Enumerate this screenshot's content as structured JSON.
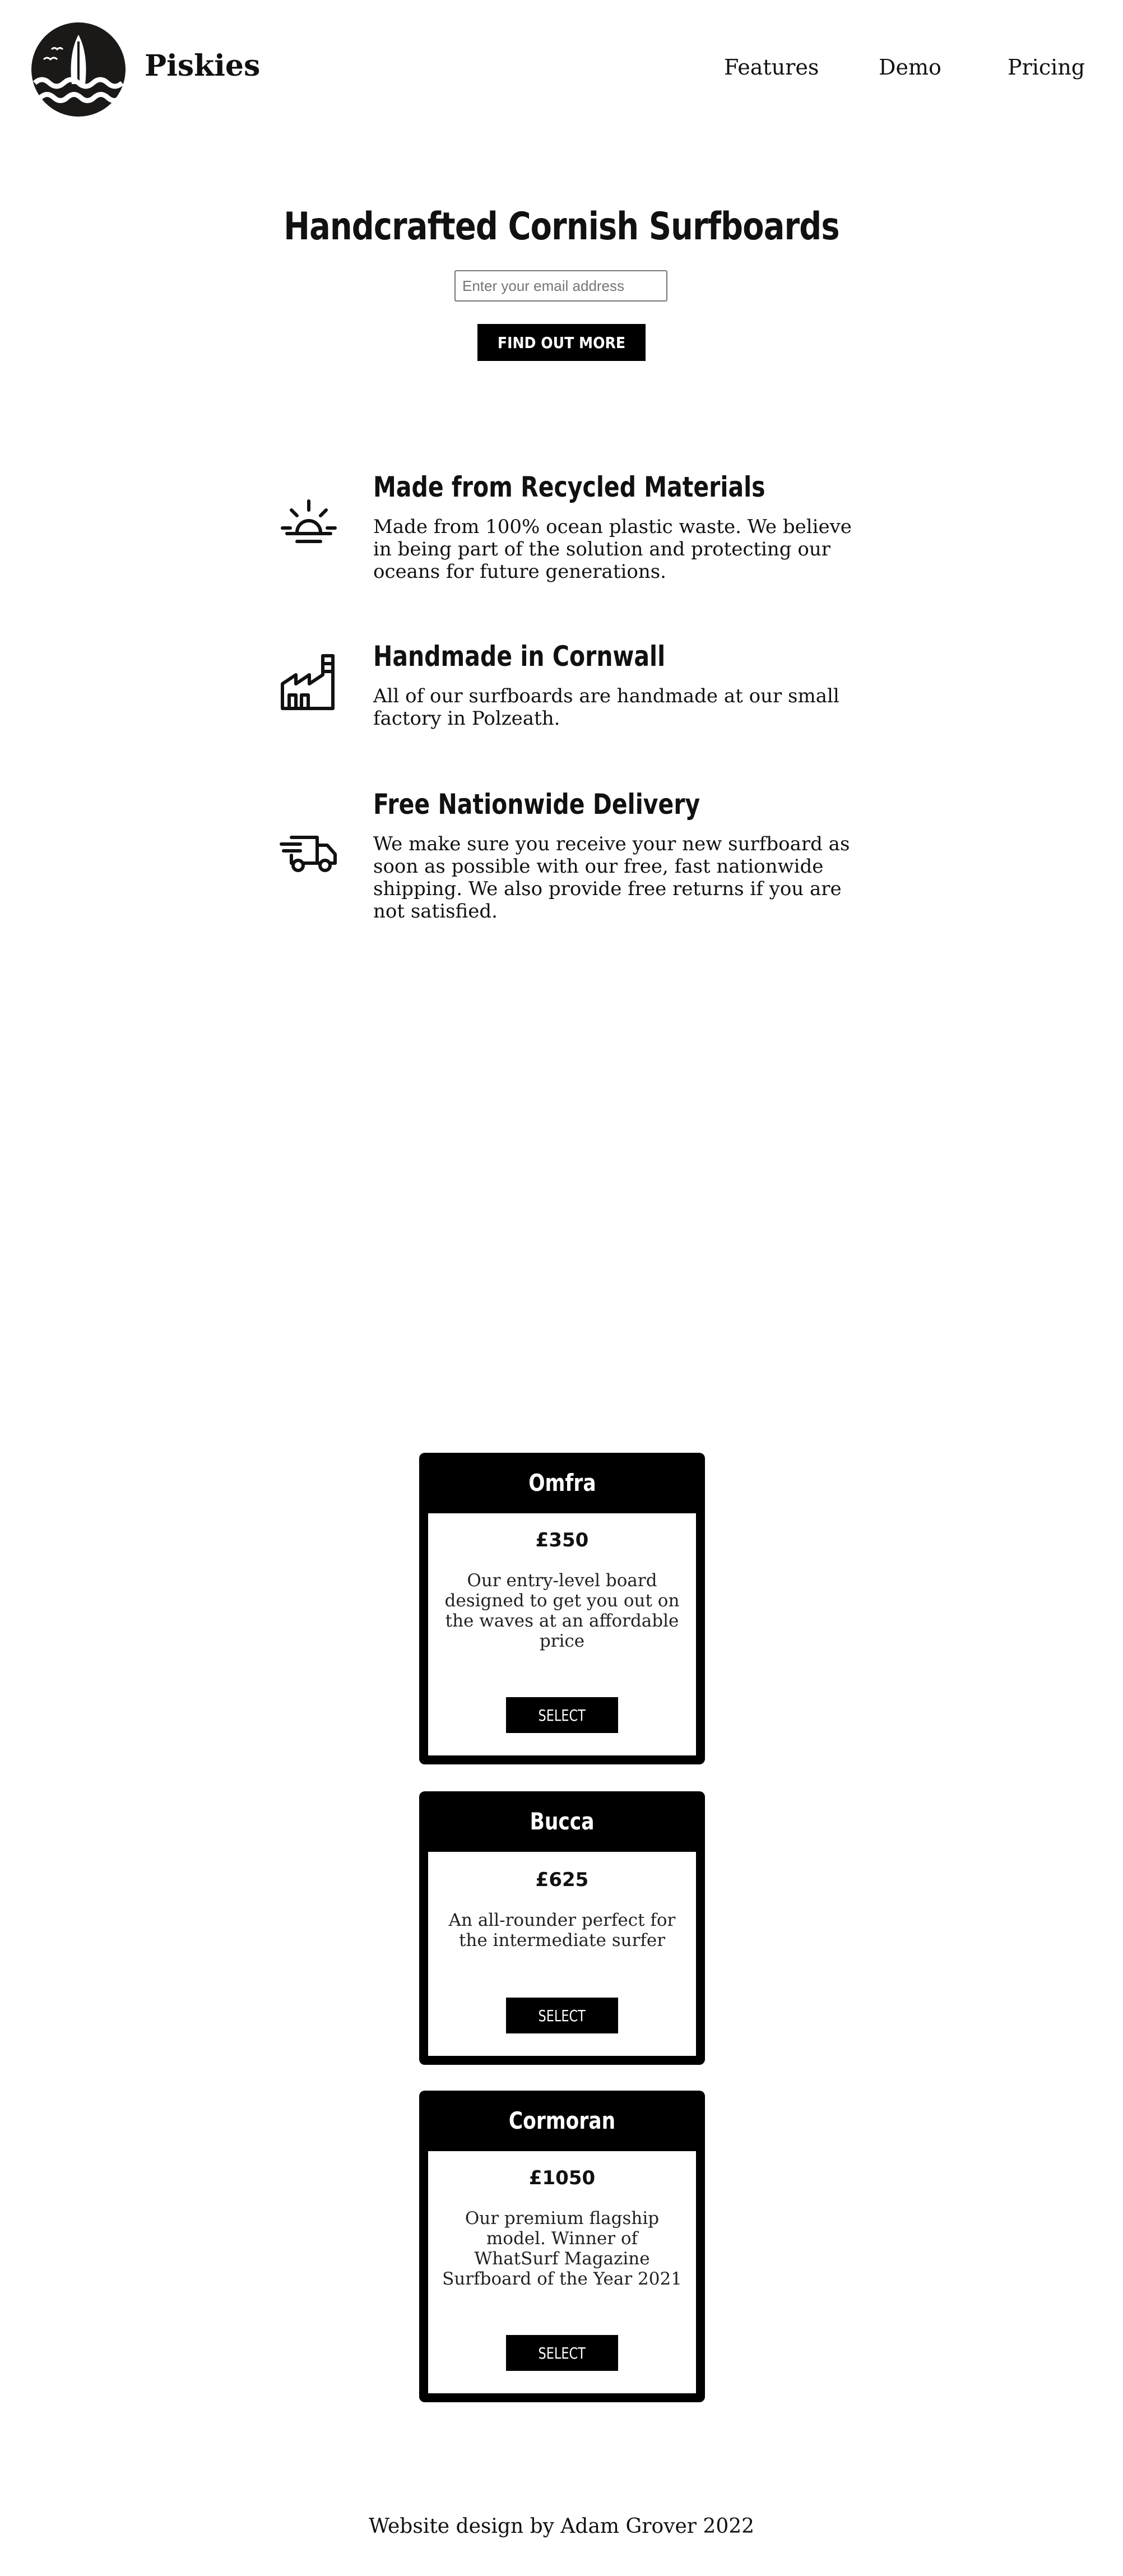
{
  "brand": {
    "name": "Piskies",
    "logo_icon": "surfboard-waves-logo-icon"
  },
  "nav": {
    "links": [
      "Features",
      "Demo",
      "Pricing"
    ]
  },
  "hero": {
    "title": "Handcrafted Cornish Surfboards",
    "email_placeholder": "Enter your email address",
    "cta_label": "FIND OUT MORE"
  },
  "features": [
    {
      "icon": "sunrise-icon",
      "title": "Made from Recycled Materials",
      "text": "Made from 100% ocean plastic waste. We believe in being part of the solution and protecting our oceans for future generations."
    },
    {
      "icon": "factory-icon",
      "title": "Handmade in Cornwall",
      "text": "All of our surfboards are handmade at our small factory in Polzeath."
    },
    {
      "icon": "delivery-truck-icon",
      "title": "Free Nationwide Delivery",
      "text": "We make sure you receive your new surfboard as soon as possible with our free, fast nationwide shipping. We also provide free returns if you are not satisfied."
    }
  ],
  "pricing": [
    {
      "name": "Omfra",
      "price": "£350",
      "description": "Our entry-level board designed to get you out on the waves at an affordable price",
      "button": "SELECT"
    },
    {
      "name": "Bucca",
      "price": "£625",
      "description": "An all-rounder perfect for the intermediate surfer",
      "button": "SELECT"
    },
    {
      "name": "Cormoran",
      "price": "£1050",
      "description": "Our premium flagship model. Winner of WhatSurf Magazine Surfboard of the Year 2021",
      "button": "SELECT"
    }
  ],
  "footer": {
    "text": "Website design by Adam Grover 2022"
  }
}
